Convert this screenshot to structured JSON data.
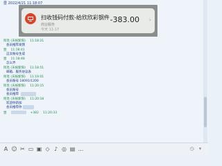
{
  "header": {
    "text": "昼 2022/4/21 11:18:07"
  },
  "card": {
    "title": "扫收钱码付款-给欣欣彩钢件",
    "subtitle": "商业服务",
    "time": "今天 11:17",
    "amount": "-383.00",
    "chevron": "›"
  },
  "messages": [
    {
      "sender": "阿毛 (天祝新阳)",
      "time": "11:18:21",
      "body": "会员推荐发我"
    },
    {
      "sender": "昼",
      "time": "11:18:41",
      "body": "这没账号生成"
    },
    {
      "sender": "昼",
      "time": "11:18:48",
      "body": "怎么弄"
    },
    {
      "sender": "阿毛 (天祝新阳)",
      "time": "11:18:51",
      "body": "邮箱、服务协议表"
    },
    {
      "sender": "阿毛 (天祝新阳)",
      "time": "11:19:01",
      "body": "会员账号 18091/1200"
    },
    {
      "sender": "阿毛 (天祝新阳)",
      "time": "11:20:15",
      "body": "会员账号"
    },
    {
      "sender": "",
      "time": "",
      "body": "会员推荐"
    },
    {
      "sender": "阿毛 (天祝新阳)",
      "time": "11:20:18",
      "body": "欢迎你新加"
    },
    {
      "sender": "",
      "time": "",
      "body": "会员推荐你"
    },
    {
      "sender": "昼",
      "time": "11:20:33",
      "body": "+382"
    }
  ],
  "toolbar": {
    "icons": [
      "font-icon",
      "emoji-icon",
      "screenshot-icon",
      "folder-icon",
      "image-icon",
      "sticker-icon",
      "mic-icon",
      "shake-icon",
      "gift-icon",
      "more-icon"
    ],
    "right_icons": [
      "clock-icon",
      "fold-icon"
    ]
  },
  "colors": {
    "sender_green": "#1f8a4e",
    "body_blue": "#1a3a8c",
    "card_icon_red": "#d9442b"
  }
}
